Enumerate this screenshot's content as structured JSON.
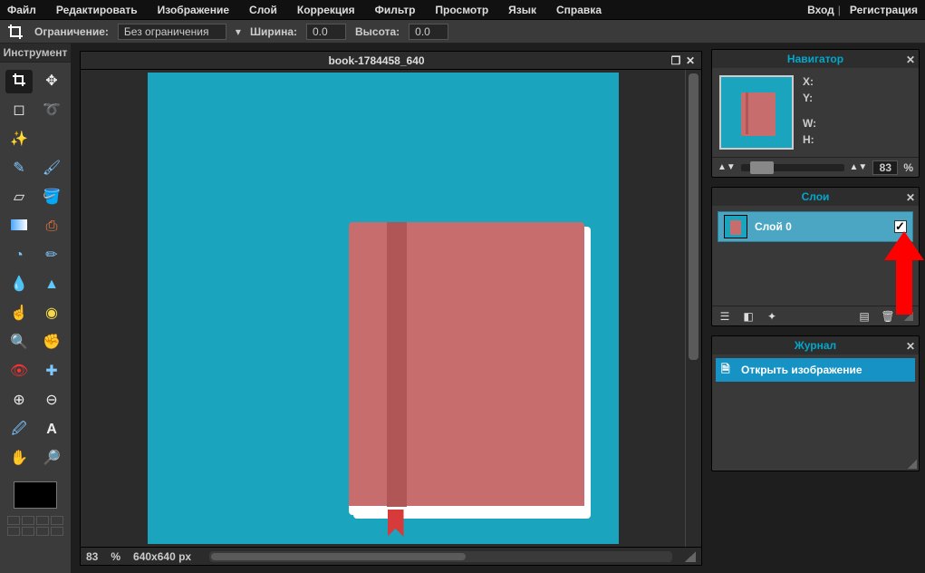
{
  "menu": {
    "items": [
      "Файл",
      "Редактировать",
      "Изображение",
      "Слой",
      "Коррекция",
      "Фильтр",
      "Просмотр",
      "Язык",
      "Справка"
    ],
    "login": "Вход",
    "register": "Регистрация"
  },
  "optbar": {
    "constraint_label": "Ограничение:",
    "constraint_value": "Без ограничения",
    "width_label": "Ширина:",
    "width_value": "0.0",
    "height_label": "Высота:",
    "height_value": "0.0"
  },
  "toolbox": {
    "title": "Инструмент"
  },
  "document": {
    "title": "book-1784458_640",
    "zoom": "83",
    "zoom_pct": "%",
    "dimensions": "640x640 px"
  },
  "navigator": {
    "title": "Навигатор",
    "x_label": "X:",
    "y_label": "Y:",
    "w_label": "W:",
    "h_label": "H:",
    "zoom": "83",
    "pct": "%"
  },
  "layers": {
    "title": "Слои",
    "layer0": "Слой 0"
  },
  "history": {
    "title": "Журнал",
    "open_image": "Открыть изображение"
  }
}
